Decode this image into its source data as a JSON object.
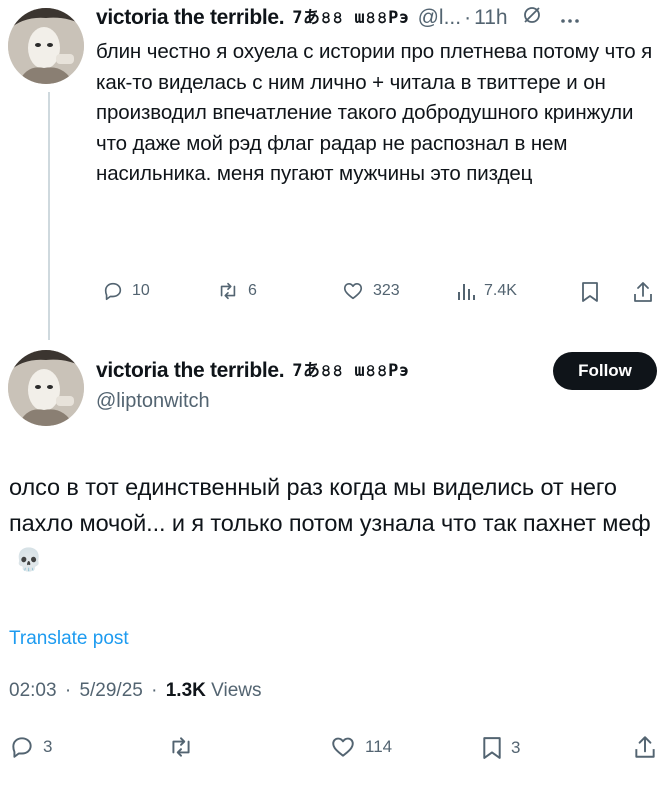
{
  "tweet1": {
    "author_name": "victoria the terrible.",
    "author_glyphs": "7あ৪৪ ɯ৪৪Pэ",
    "handle": "@l...",
    "separator": "·",
    "time": "11h",
    "text": "блин честно я охуела с истории про плетнева потому что я как-то виделась с ним лично + читала в твиттере и он производил впечатление такого добродушного кринжули что даже мой рэд флаг радар не распознал в нем насильника. меня пугают мужчины это пиздец",
    "actions": {
      "replies": "10",
      "reposts": "6",
      "likes": "323",
      "views": "7.4K"
    }
  },
  "tweet2": {
    "author_name": "victoria the terrible.",
    "author_glyphs": "7あ৪৪ ɯ৪৪Pэ",
    "handle": "@liptonwitch",
    "follow_label": "Follow",
    "text": "олсо в тот единственный раз когда мы виделись от него пахло мочой... и я только потом узнала что так пахнет меф",
    "emoji": "💀",
    "translate_label": "Translate post",
    "time": "02:03",
    "date": "5/29/25",
    "separator": "·",
    "views_count": "1.3K",
    "views_label": "Views",
    "actions": {
      "replies": "3",
      "likes": "114",
      "bookmarks": "3"
    }
  },
  "icons": [
    "avatar-image",
    "reply-icon",
    "repost-icon",
    "like-icon",
    "views-icon",
    "bookmark-icon",
    "share-icon",
    "grok-icon",
    "more-icon",
    "skull-emoji"
  ],
  "colors": {
    "text": "#0f1419",
    "muted": "#536471",
    "link": "#1d9bf0",
    "follow_button": "#0f1419",
    "thread_line": "#cfd9de"
  }
}
